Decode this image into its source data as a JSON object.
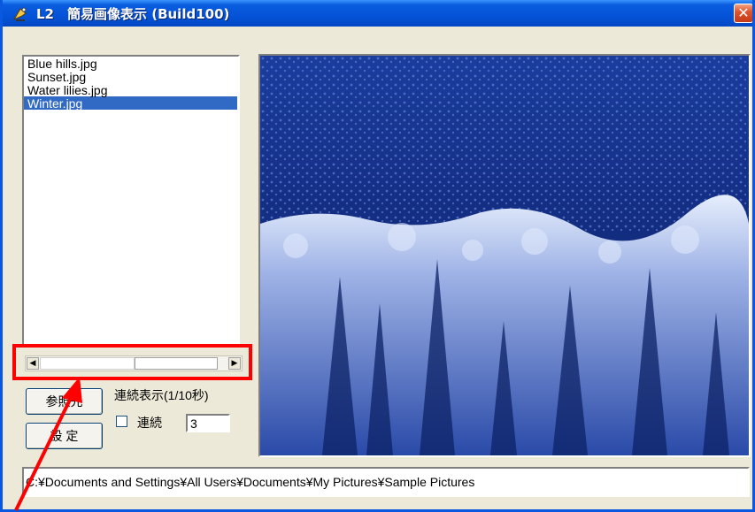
{
  "window": {
    "title": "L2　簡易画像表示 (Build100)",
    "close_symbol": "✕"
  },
  "file_list": {
    "items": [
      {
        "label": "Blue hills.jpg",
        "selected": false
      },
      {
        "label": "Sunset.jpg",
        "selected": false
      },
      {
        "label": "Water lilies.jpg",
        "selected": false
      },
      {
        "label": "Winter.jpg",
        "selected": true
      }
    ]
  },
  "scrollbar": {
    "left_arrow": "◀",
    "right_arrow": "▶"
  },
  "buttons": {
    "browse_label": "参照先",
    "settings_label": "設 定"
  },
  "continuous": {
    "group_label": "連続表示(1/10秒)",
    "checkbox_label": "連続",
    "checked": false,
    "interval_value": "3"
  },
  "preview": {
    "image_description_icon": "winter-forest-image"
  },
  "path": {
    "value": "C:¥Documents and Settings¥All Users¥Documents¥My Pictures¥Sample Pictures"
  },
  "colors": {
    "titlebar": "#0553d8",
    "selection": "#316ac5",
    "highlight": "#ff0000"
  }
}
